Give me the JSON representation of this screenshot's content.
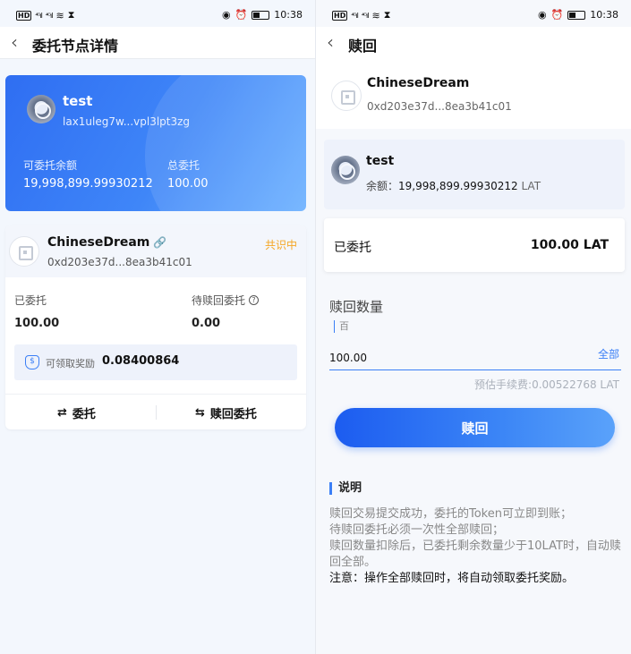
{
  "status_bar": {
    "time": "10:38",
    "chip": "HD",
    "signal_1": "⁴ᴳıl",
    "signal_2": "⁴ᴳıl"
  },
  "left": {
    "nav": {
      "title": "委托节点详情"
    },
    "wallet_card": {
      "name": "test",
      "address": "lax1uleg7w...vpl3lpt3zg",
      "available_label": "可委托余额",
      "available_value": "19,998,899.99930212",
      "total_label": "总委托",
      "total_value": "100.00"
    },
    "node_card": {
      "name": "ChineseDream",
      "address": "0xd203e37d...8ea3b41c01",
      "status": "共识中",
      "delegated_label": "已委托",
      "delegated_value": "100.00",
      "pending_label": "待赎回委托",
      "pending_value": "0.00",
      "reward_label": "可领取奖励",
      "reward_value": "0.08400864",
      "delegate_button": "委托",
      "redeem_button": "赎回委托"
    }
  },
  "right": {
    "nav": {
      "title": "赎回"
    },
    "node": {
      "name": "ChineseDream",
      "address": "0xd203e37d...8ea3b41c01"
    },
    "wallet": {
      "name": "test",
      "balance_label": "余额：",
      "balance_value": "19,998,899.99930212",
      "balance_unit": "LAT"
    },
    "delegated": {
      "label": "已委托",
      "value": "100.00 LAT"
    },
    "form": {
      "title": "赎回数量",
      "hint": "百",
      "amount": "100.00",
      "all_label": "全部",
      "fee": "预估手续费:0.00522768 LAT",
      "submit_label": "赎回"
    },
    "notes": {
      "title": "说明",
      "line1": "赎回交易提交成功，委托的Token可立即到账；",
      "line2": "待赎回委托必须一次性全部赎回；",
      "line3": "赎回数量扣除后，已委托剩余数量少于10LAT时，自动赎回全部。",
      "line4": "注意：操作全部赎回时，将自动领取委托奖励。"
    }
  },
  "colors": {
    "accent": "#3b7ff6",
    "status_consensus": "#f5a623",
    "card_gradient_start": "#2f6ef2",
    "card_gradient_end": "#6ab0ff"
  }
}
